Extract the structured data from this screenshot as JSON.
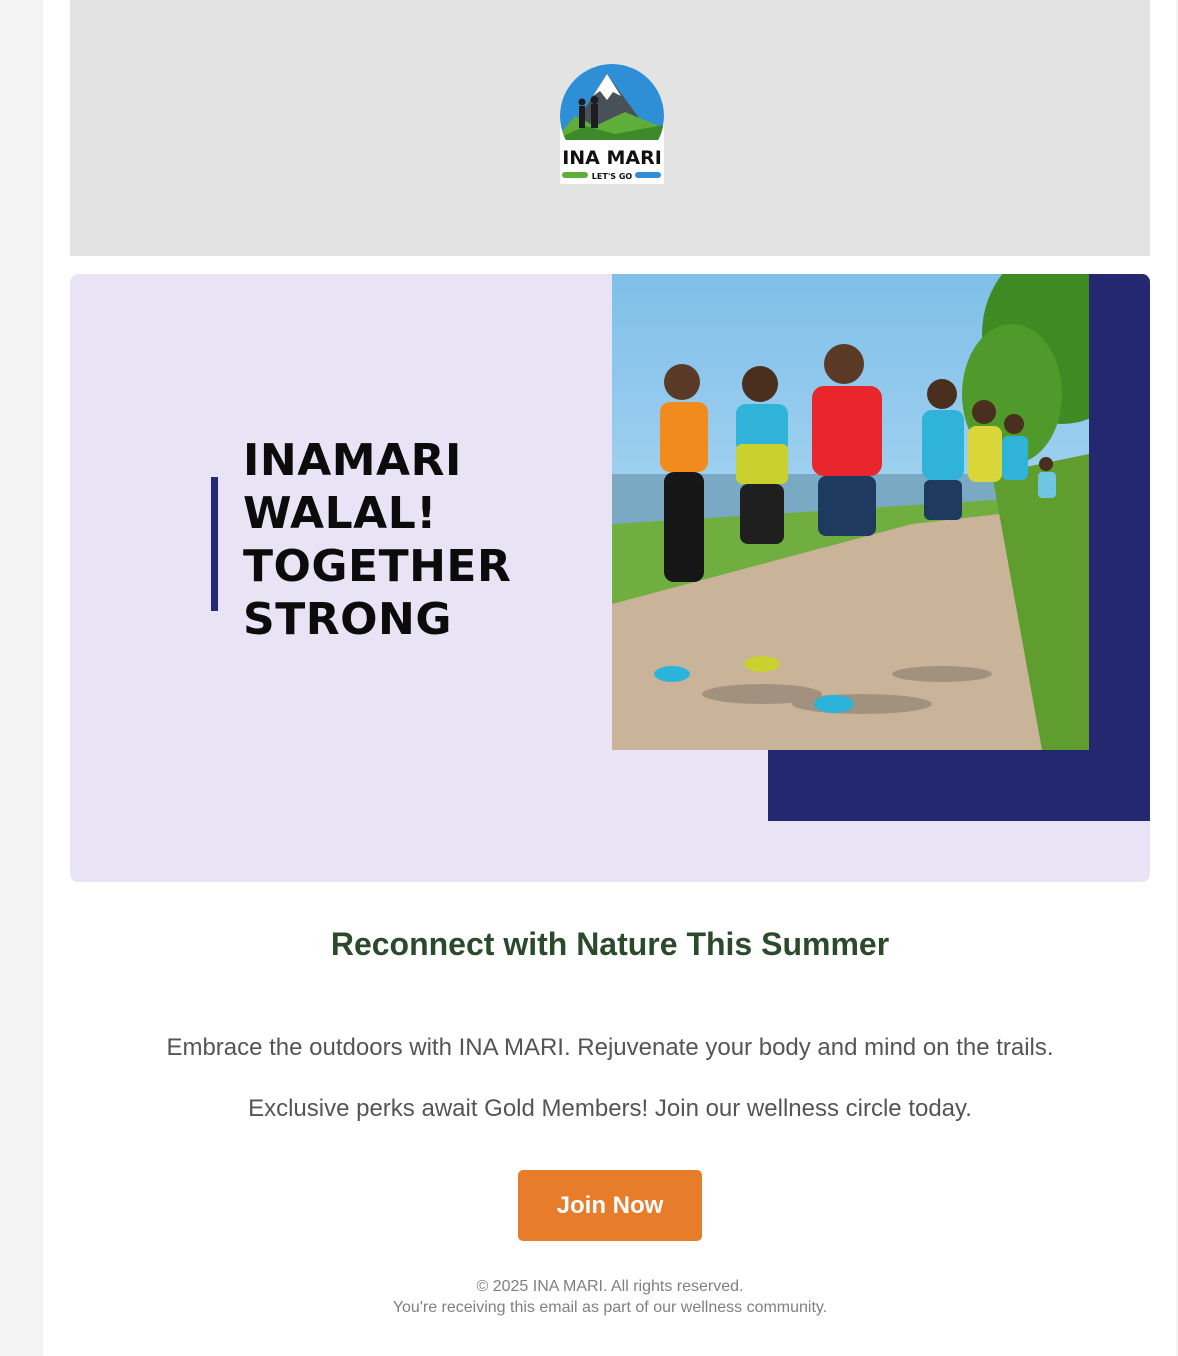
{
  "logo": {
    "brand": "INA MARI",
    "tagline": "LET'S GO"
  },
  "hero": {
    "headline_lines": [
      "INAMARI",
      "WALAL!",
      "TOGETHER",
      "STRONG"
    ],
    "photo_icon": "group-running-photo"
  },
  "content": {
    "title": "Reconnect with Nature This Summer",
    "paragraph_1": "Embrace the outdoors with INA MARI. Rejuvenate your body and mind on the trails.",
    "paragraph_2": "Exclusive perks await Gold Members! Join our wellness circle today."
  },
  "cta": {
    "label": "Join Now"
  },
  "footer": {
    "copyright": "© 2025 INA MARI. All rights reserved.",
    "note": "You're receiving this email as part of our wellness community."
  },
  "colors": {
    "header_bg": "#e3e3e3",
    "hero_bg": "#e8e4f6",
    "navy_accent": "#232870",
    "title_green": "#2b4a2c",
    "cta_orange": "#e77c2a",
    "body_text": "#555555",
    "footer_text": "#808080"
  }
}
